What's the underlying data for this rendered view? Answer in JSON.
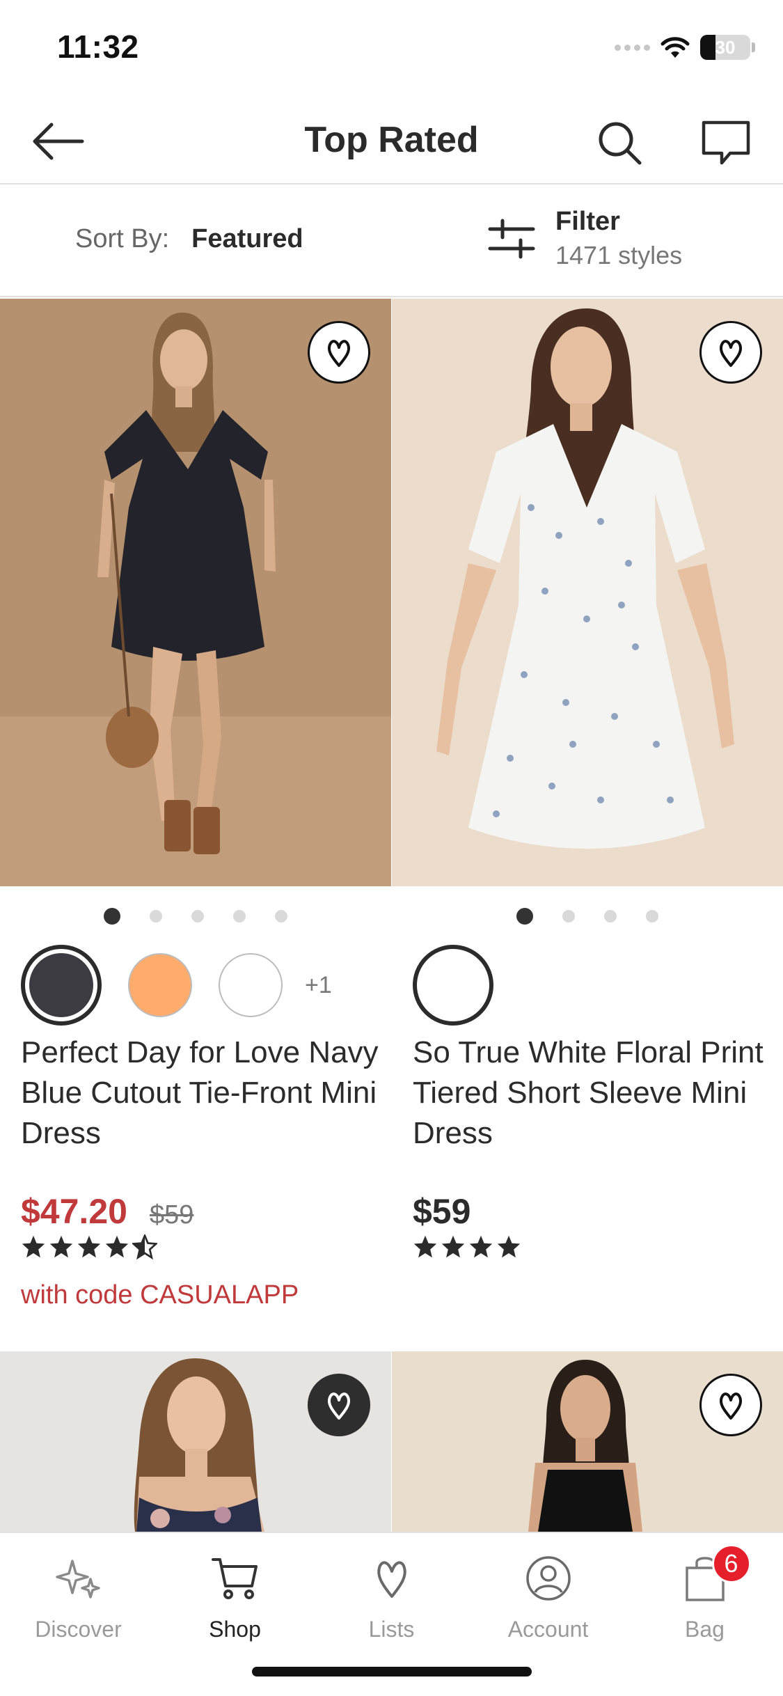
{
  "status_bar": {
    "time": "11:32",
    "battery_level": "30"
  },
  "header": {
    "title": "Top Rated"
  },
  "sort_filter": {
    "sort_label": "Sort By:",
    "sort_value": "Featured",
    "filter_label": "Filter",
    "filter_count": "1471 styles"
  },
  "products": [
    {
      "name": "Perfect Day for Love Navy Blue Cutout Tie-Front Mini Dress",
      "price": "$47.20",
      "original_price": "$59",
      "promo": "with code CASUALAPP",
      "rating": 4.5,
      "image_count": 5,
      "active_image": 1,
      "swatches": [
        "#3d3b42",
        "#ffab6b",
        "#ffffff"
      ],
      "more_swatches": "+1",
      "wishlisted": false
    },
    {
      "name": "So True White Floral Print Tiered Short Sleeve Mini Dress",
      "price": "$59",
      "rating": 4,
      "image_count": 4,
      "active_image": 1,
      "swatches": [
        "#ffffff"
      ],
      "wishlisted": false
    },
    {
      "wishlisted": true
    },
    {
      "wishlisted": false
    }
  ],
  "tab_bar": {
    "tabs": [
      {
        "label": "Discover",
        "icon": "sparkle-icon"
      },
      {
        "label": "Shop",
        "icon": "cart-icon"
      },
      {
        "label": "Lists",
        "icon": "heart-v-icon"
      },
      {
        "label": "Account",
        "icon": "user-icon"
      },
      {
        "label": "Bag",
        "icon": "bag-icon"
      }
    ],
    "active": "Shop",
    "bag_badge": "6"
  },
  "colors": {
    "accent": "#c0393b",
    "badge": "#e5202a",
    "text": "#2b2b2b"
  }
}
